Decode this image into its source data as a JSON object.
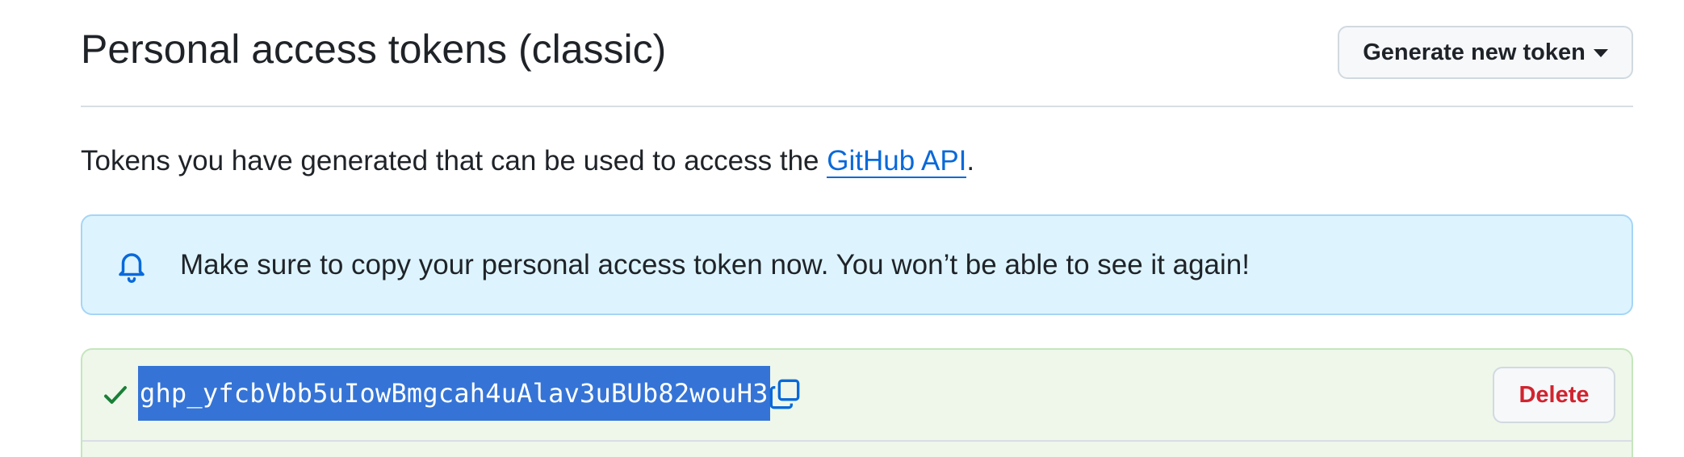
{
  "header": {
    "title": "Personal access tokens (classic)",
    "generate_button_label": "Generate new token",
    "generate_button_icon": "triangle-down-icon"
  },
  "description": {
    "prefix": "Tokens you have generated that can be used to access the ",
    "link_text": "GitHub API",
    "suffix": "."
  },
  "flash": {
    "icon": "bell-icon",
    "message": "Make sure to copy your personal access token now. You won’t be able to see it again!"
  },
  "token": {
    "status_icon": "check-icon",
    "value": "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",
    "copy_icon": "copy-icon",
    "delete_label": "Delete"
  },
  "colors": {
    "link": "#0969da",
    "flash_bg": "#ddf4ff",
    "token_bg": "#eef7ea",
    "selection": "#3574d6",
    "delete": "#d1242f",
    "success": "#1a7f37"
  }
}
